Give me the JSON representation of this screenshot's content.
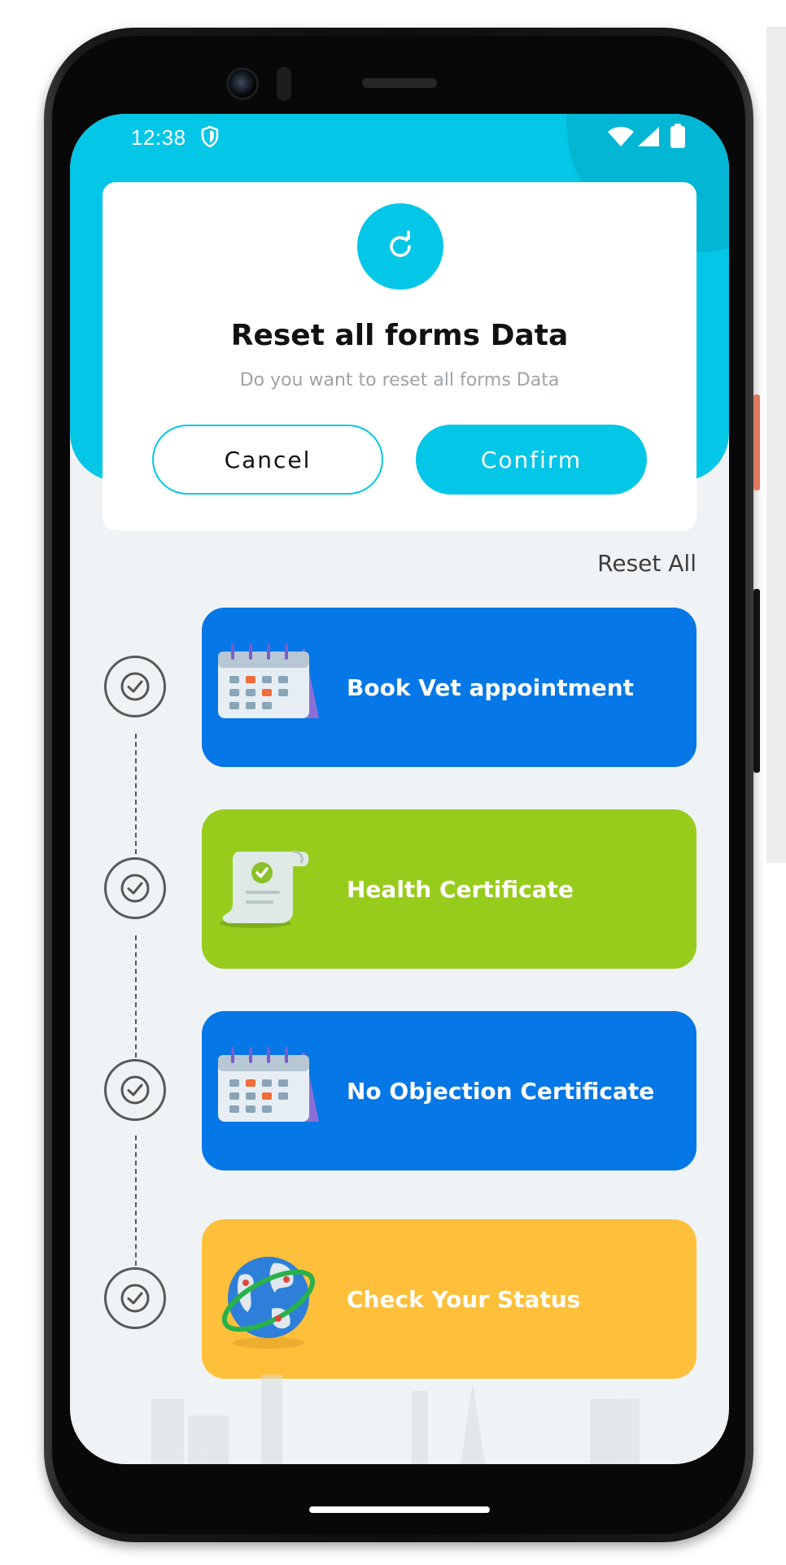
{
  "status_bar": {
    "time": "12:38",
    "icons": [
      "shield-icon",
      "wifi-icon",
      "signal-icon",
      "battery-icon"
    ]
  },
  "dialog": {
    "icon": "refresh-icon",
    "title": "Reset all forms Data",
    "message": "Do you want to reset all forms Data",
    "cancel_label": "Cancel",
    "confirm_label": "Confirm"
  },
  "reset_all_label": "Reset All",
  "steps": [
    {
      "label": "Book Vet appointment",
      "icon": "calendar-icon",
      "color": "#0577e6"
    },
    {
      "label": "Health Certificate",
      "icon": "certificate-scroll-icon",
      "color": "#97cc1d"
    },
    {
      "label": "No Objection Certificate",
      "icon": "calendar-icon",
      "color": "#0577e6"
    },
    {
      "label": "Check Your Status",
      "icon": "globe-icon",
      "color": "#fec03a"
    }
  ],
  "colors": {
    "accent": "#04c6e6",
    "background": "#f0f3f5"
  }
}
